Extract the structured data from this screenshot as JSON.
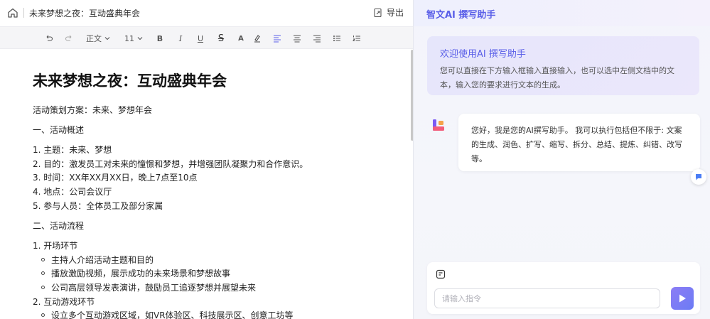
{
  "document": {
    "breadcrumb_title": "未来梦想之夜：互动盛典年会",
    "export_label": "导出",
    "heading": "未来梦想之夜：互动盛典年会",
    "lines": [
      "活动策划方案：未来、梦想年会",
      "一、活动概述",
      "1. 主题：未来、梦想",
      "2. 目的：激发员工对未来的憧憬和梦想，并增强团队凝聚力和合作意识。",
      "3. 时间：XX年XX月XX日，晚上7点至10点",
      "4. 地点：公司会议厅",
      "5. 参与人员：全体员工及部分家属",
      "二、活动流程",
      "1. 开场环节",
      "2. 互动游戏环节"
    ],
    "bullets": [
      "主持人介绍活动主题和目的",
      "播放激励视频，展示成功的未来场景和梦想故事",
      "公司高层领导发表演讲，鼓励员工追逐梦想并展望未来",
      "设立多个互动游戏区域，如VR体验区、科技展示区、创意工坊等"
    ]
  },
  "toolbar": {
    "paragraph_style": "正文",
    "font_size": "11",
    "bold": "B",
    "italic": "I",
    "underline": "U",
    "strike": "S",
    "font_color": "A",
    "accent_color": "#5a5fe8"
  },
  "assistant": {
    "title": "智文AI 撰写助手",
    "welcome_title": "欢迎使用AI 撰写助手",
    "welcome_desc": "您可以直接在下方输入框输入直接输入，也可以选中左侧文档中的文本，输入您的要求进行文本的生成。",
    "greeting": "您好，我是您的AI撰写助手。 我可以执行包括但不限于: 文案的生成、润色、扩写、缩写、拆分、总结、提炼、纠错、改写等。",
    "input_placeholder": "请输入指令"
  }
}
